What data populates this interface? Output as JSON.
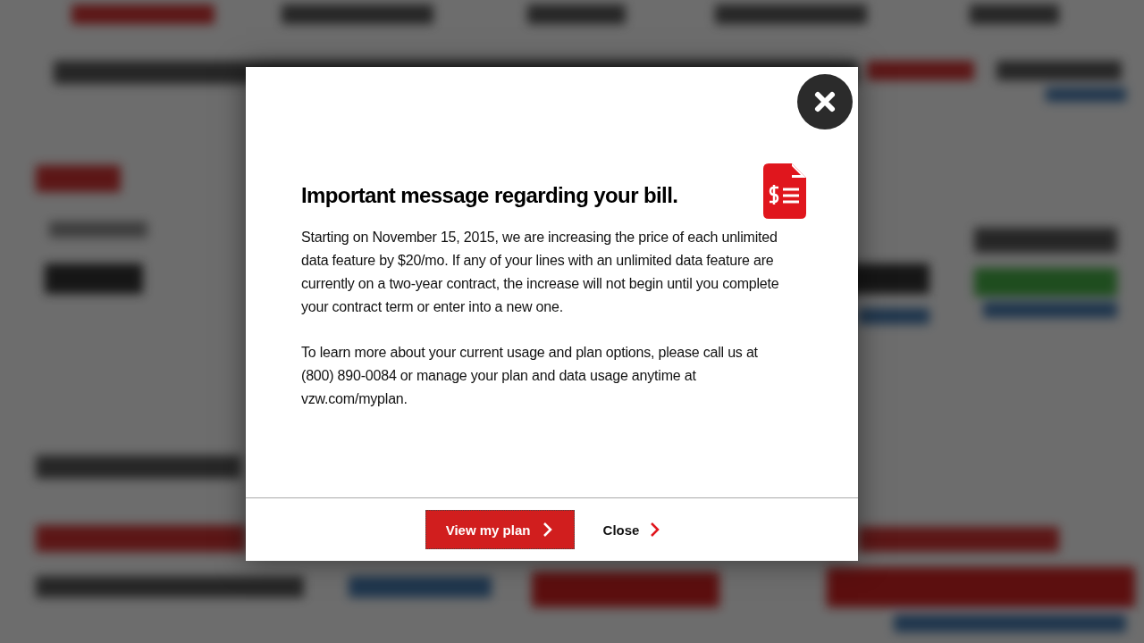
{
  "dialog": {
    "title": "Important message regarding your bill.",
    "paragraphs": [
      "Starting on November 15, 2015, we are increasing the price of each unlimited data feature by $20/mo. If any of your lines with an unlimited data feature are currently on a two-year contract, the increase will not begin until you complete your contract term or enter into a new one.",
      "To learn more about your current usage and plan options, please call us at (800) 890-0084 or manage your plan and data usage anytime at vzw.com/myplan."
    ],
    "buttons": [
      {
        "kind": "primary",
        "label": "View my plan"
      },
      {
        "kind": "link",
        "label": "Close"
      }
    ]
  }
}
